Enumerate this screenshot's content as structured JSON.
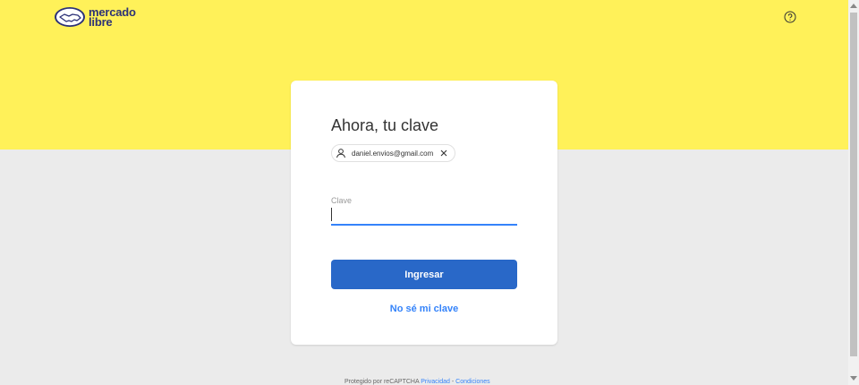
{
  "header": {
    "logo_line1": "mercado",
    "logo_line2": "libre",
    "help_icon": "question-circle-icon"
  },
  "login": {
    "title": "Ahora, tu clave",
    "email": "daniel.envios@gmail.com",
    "password_label": "Clave",
    "password_value": "",
    "submit_label": "Ingresar",
    "forgot_label": "No sé mi clave"
  },
  "footer": {
    "text": "Protegido por reCAPTCHA",
    "privacy_label": "Privacidad",
    "terms_label": "Condiciones"
  },
  "colors": {
    "header_yellow": "#fff159",
    "primary_blue": "#2968c8",
    "link_blue": "#3483fa",
    "page_bg": "#ebebeb"
  }
}
